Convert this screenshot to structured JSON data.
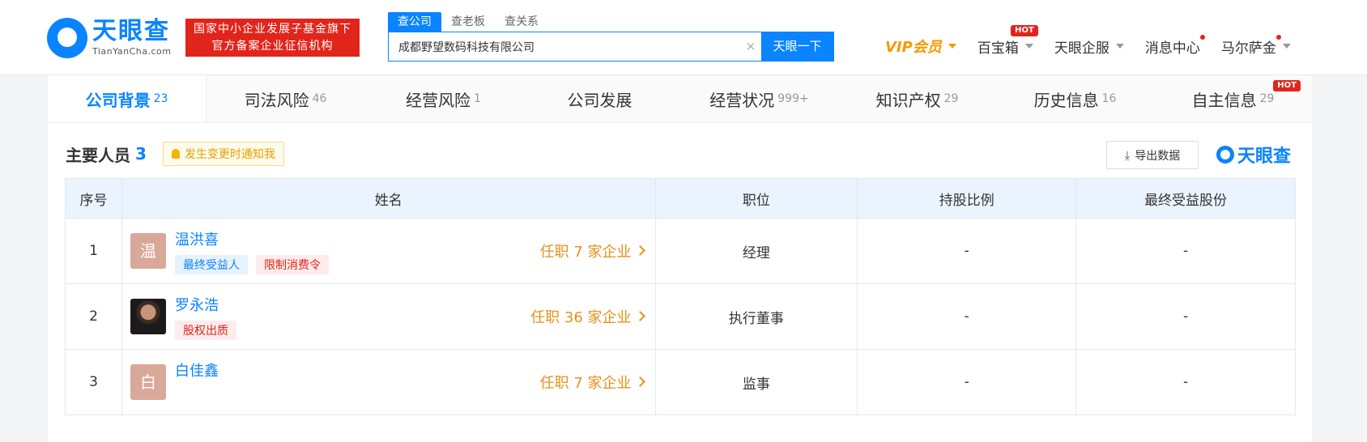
{
  "header": {
    "logo_main": "天眼查",
    "logo_sub": "TianYanCha.com",
    "badge_line1": "国家中小企业发展子基金旗下",
    "badge_line2": "官方备案企业征信机构",
    "search_tabs": [
      "查公司",
      "查老板",
      "查关系"
    ],
    "search_value": "成都野望数码科技有限公司",
    "clear_glyph": "×",
    "search_button": "天眼一下",
    "nav": {
      "vip": "VIP会员",
      "baibaoxiang": "百宝箱",
      "hot": "HOT",
      "qifu": "天眼企服",
      "messages": "消息中心",
      "user": "马尔萨金"
    }
  },
  "tabs": [
    {
      "label": "公司背景",
      "count": "23"
    },
    {
      "label": "司法风险",
      "count": "46"
    },
    {
      "label": "经营风险",
      "count": "1"
    },
    {
      "label": "公司发展",
      "count": ""
    },
    {
      "label": "经营状况",
      "count": "999+"
    },
    {
      "label": "知识产权",
      "count": "29"
    },
    {
      "label": "历史信息",
      "count": "16"
    },
    {
      "label": "自主信息",
      "count": "29",
      "hot": "HOT"
    }
  ],
  "section": {
    "title": "主要人员",
    "count": "3",
    "notify": "发生变更时通知我",
    "export": "导出数据",
    "brand": "天眼查"
  },
  "table": {
    "headers": [
      "序号",
      "姓名",
      "职位",
      "持股比例",
      "最终受益股份"
    ],
    "rows": [
      {
        "idx": "1",
        "avatar_char": "温",
        "name": "温洪喜",
        "tags": [
          "最终受益人",
          "限制消费令"
        ],
        "jobs": "任职 7 家企业",
        "position": "经理",
        "share": "-",
        "final": "-"
      },
      {
        "idx": "2",
        "avatar_char": "",
        "name": "罗永浩",
        "tags": [
          "股权出质"
        ],
        "jobs": "任职 36 家企业",
        "position": "执行董事",
        "share": "-",
        "final": "-"
      },
      {
        "idx": "3",
        "avatar_char": "白",
        "name": "白佳鑫",
        "tags": [],
        "jobs": "任职 7 家企业",
        "position": "监事",
        "share": "-",
        "final": "-"
      }
    ]
  },
  "colors": {
    "brand_blue": "#0a84ff",
    "badge_red": "#e1251b",
    "vip_orange": "#f59a00",
    "jobs_orange": "#e9901a"
  }
}
